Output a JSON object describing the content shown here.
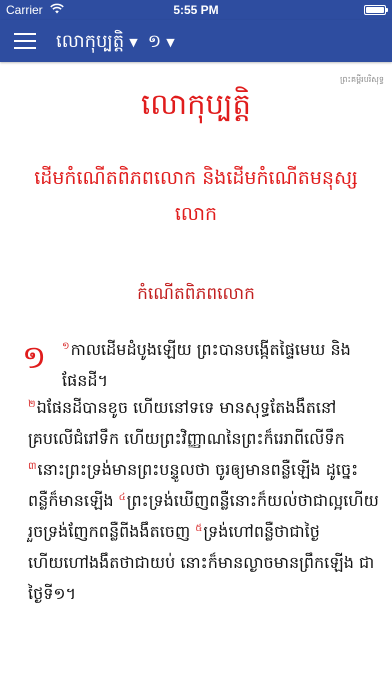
{
  "status_bar": {
    "carrier": "Carrier",
    "time": "5:55 PM"
  },
  "nav": {
    "book": "លោកុប្បត្តិ",
    "chapter": "១",
    "caret": "▼"
  },
  "content": {
    "version": "ព្រះគម្ពីរបរិសុទ្ធ",
    "book_title": "លោកុប្បត្តិ",
    "section_heading": "ដើមកំណើតពិភពលោក និងដើមកំណើតមនុស្សលោក",
    "sub_heading": "កំណើតពិភពលោក",
    "chapter_number": "១",
    "verses": [
      {
        "num": "១",
        "text": "កាលដើមដំបូងឡើយ ព្រះបានបង្កើតផ្ទៃមេឃ និងផែនដី។"
      },
      {
        "num": "២",
        "text": "ឯផែនដីបានខូច ហើយនៅទទេ មានសុទ្ធតែងងឹតនៅគ្របលើជំរៅទឹក ហើយព្រះវិញ្ញាណនៃព្រះក៏រេរាពីលើទឹក"
      },
      {
        "num": "៣",
        "text": "នោះព្រះទ្រង់មានព្រះបន្ទូលថា ចូរឲ្យមានពន្លឺឡើង ដូច្នេះ ពន្លឺក៏មានឡើង"
      },
      {
        "num": "៤",
        "text": "ព្រះទ្រង់ឃើញពន្លឺនោះក៏យល់ថាជាល្អហើយ រួចទ្រង់ញែកពន្លឺពីងងឹតចេញ"
      },
      {
        "num": "៥",
        "text": "ទ្រង់ហៅពន្លឺថាជាថ្ងៃ ហើយហៅងងឹតថាជាយប់ នោះក៏មានល្ងាចមានព្រឹកឡើង ជាថ្ងៃទី១។"
      }
    ]
  },
  "colors": {
    "bar": "#2e4da0",
    "heading_red": "#e01c1c",
    "verse_number_red": "#d93030"
  },
  "icons": {
    "menu": "hamburger-menu-icon",
    "wifi": "wifi-icon",
    "battery": "battery-icon"
  }
}
